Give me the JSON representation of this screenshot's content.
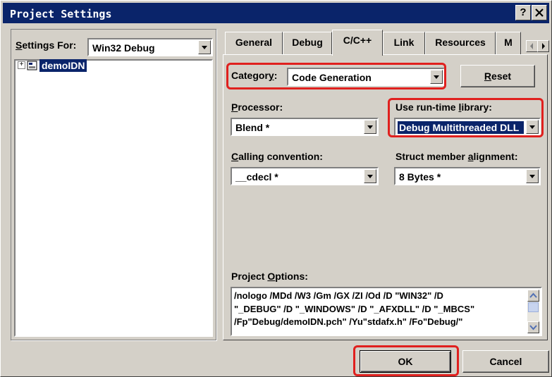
{
  "window": {
    "title": "Project Settings",
    "help": "?",
    "close": "X"
  },
  "left": {
    "settings_for_prefix": "S",
    "settings_for_rest": "ettings For:",
    "settings_for_value": "Win32 Debug",
    "tree_expander": "+",
    "tree_item": "demoIDN"
  },
  "tabs": [
    "General",
    "Debug",
    "C/C++",
    "Link",
    "Resources",
    "M"
  ],
  "active_tab": "C/C++",
  "category": {
    "label_main": "Categor",
    "label_ul": "y",
    "label_colon": ":",
    "value": "Code Generation"
  },
  "reset_button": {
    "ul": "R",
    "rest": "eset"
  },
  "processor": {
    "label_ul": "P",
    "label_rest": "rocessor:",
    "value": "Blend *"
  },
  "runtime": {
    "label_pre": "Use run-time ",
    "label_ul": "l",
    "label_rest": "ibrary:",
    "value": "Debug Multithreaded DLL"
  },
  "calling": {
    "label_ul": "C",
    "label_rest": "alling convention:",
    "value": "__cdecl *"
  },
  "struct": {
    "label_pre": "Struct member ",
    "label_ul": "a",
    "label_rest": "lignment:",
    "value": "8 Bytes *"
  },
  "options": {
    "label_pre": "Project ",
    "label_ul": "O",
    "label_rest": "ptions:",
    "lines": [
      "/nologo /MDd /W3 /Gm /GX /ZI /Od /D \"WIN32\" /D",
      "\"_DEBUG\" /D \"_WINDOWS\" /D \"_AFXDLL\" /D \"_MBCS\"",
      "/Fp\"Debug/demoIDN.pch\" /Yu\"stdafx.h\" /Fo\"Debug/\""
    ]
  },
  "footer": {
    "ok": "OK",
    "cancel": "Cancel"
  },
  "colors": {
    "title_bg": "#0a246a",
    "dialog_bg": "#d4d0c8",
    "highlight": "#e0201e",
    "selection": "#0a246a"
  }
}
